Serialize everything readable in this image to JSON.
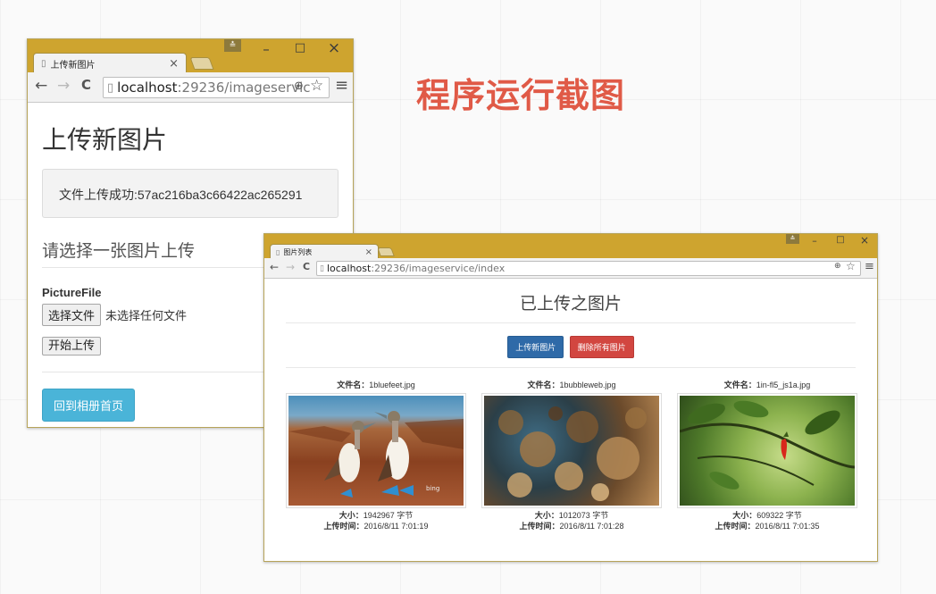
{
  "slide_title": "程序运行截图",
  "upload_window": {
    "tab_title": "上传新图片",
    "tab_close": "×",
    "url_host": "localhost",
    "url_path": ":29236/imageservic",
    "page_heading": "上传新图片",
    "success_message": "文件上传成功:57ac216ba3c66422ac265291",
    "section_heading": "请选择一张图片上传",
    "field_label": "PictureFile",
    "choose_file_label": "选择文件",
    "no_file_text": "未选择任何文件",
    "submit_label": "开始上传",
    "back_label": "回到相册首页"
  },
  "gallery_window": {
    "tab_title": "图片列表",
    "tab_close": "×",
    "url_host": "localhost",
    "url_path": ":29236/imageservice/index",
    "page_title": "已上传之图片",
    "upload_button": "上传新图片",
    "delete_button": "删除所有图片",
    "images": [
      {
        "name_label": "文件名：",
        "filename": "1bluefeet.jpg",
        "size_label": "大小：",
        "size": "1942967 字节",
        "time_label": "上传时间：",
        "time": "2016/8/11 7:01:19",
        "watermark": "bing"
      },
      {
        "name_label": "文件名：",
        "filename": "1bubbleweb.jpg",
        "size_label": "大小：",
        "size": "1012073 字节",
        "time_label": "上传时间：",
        "time": "2016/8/11 7:01:28"
      },
      {
        "name_label": "文件名：",
        "filename": "1in-fl5_js1a.jpg",
        "size_label": "大小：",
        "size": "609322 字节",
        "time_label": "上传时间：",
        "time": "2016/8/11 7:01:35"
      }
    ]
  },
  "window_controls": {
    "minimize": "–",
    "maximize": "□",
    "close": "×",
    "user": "≛"
  },
  "nav_icons": {
    "back": "←",
    "forward": "→",
    "reload": "C",
    "page": "▯",
    "zoom": "⊕",
    "star": "☆",
    "menu": "≡"
  },
  "colors": {
    "titlebar": "#cea42f",
    "slide_title": "#e05a47",
    "btn_blue": "#2f6aa8",
    "btn_red": "#d24640",
    "btn_info": "#4ab4d8"
  }
}
